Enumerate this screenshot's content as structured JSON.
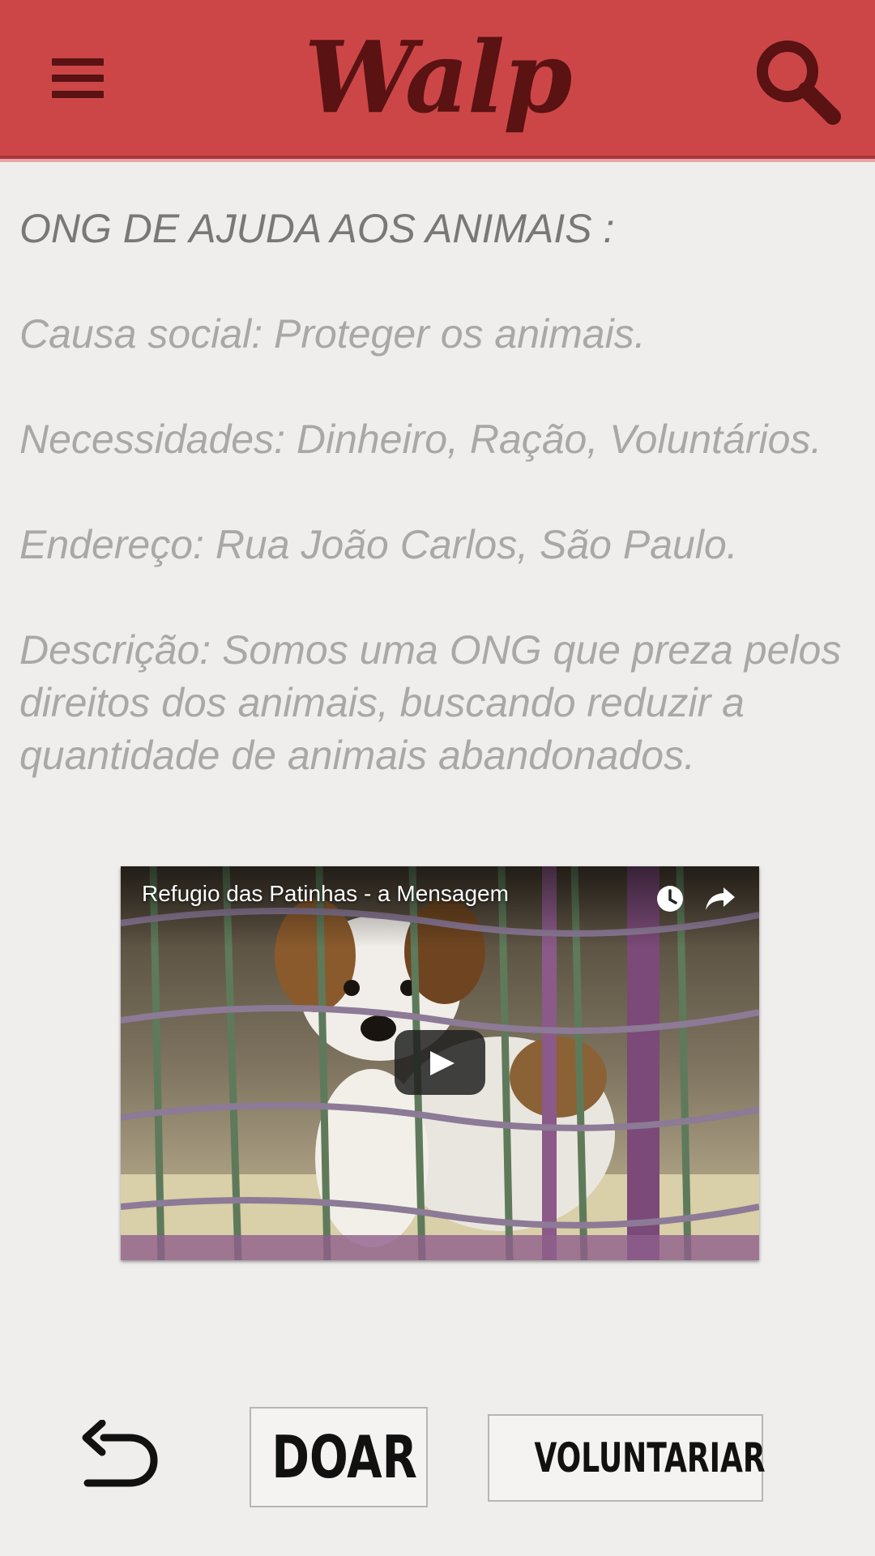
{
  "header": {
    "logo": "Walp",
    "menu_icon": "hamburger-menu-icon",
    "search_icon": "search-icon",
    "background_color": "#cc4648",
    "accent_color": "#5a1212"
  },
  "content": {
    "heading": "ONG DE AJUDA AOS ANIMAIS :",
    "causa": "Causa social: Proteger os animais.",
    "necessidades": "Necessidades: Dinheiro, Ração, Voluntários.",
    "endereco": "Endereço: Rua João Carlos, São Paulo.",
    "descricao": "Descrição: Somos uma ONG que preza pelos direitos dos animais, buscando reduzir a quantidade de animais abandonados."
  },
  "video": {
    "title": "Refugio das Patinhas - a Mensagem",
    "watch_later_icon": "clock-icon",
    "share_icon": "share-icon",
    "play_icon": "play-icon"
  },
  "actions": {
    "back_icon": "back-arrow-icon",
    "donate_label": "DOAR",
    "volunteer_label": "VOLUNTARIAR"
  }
}
